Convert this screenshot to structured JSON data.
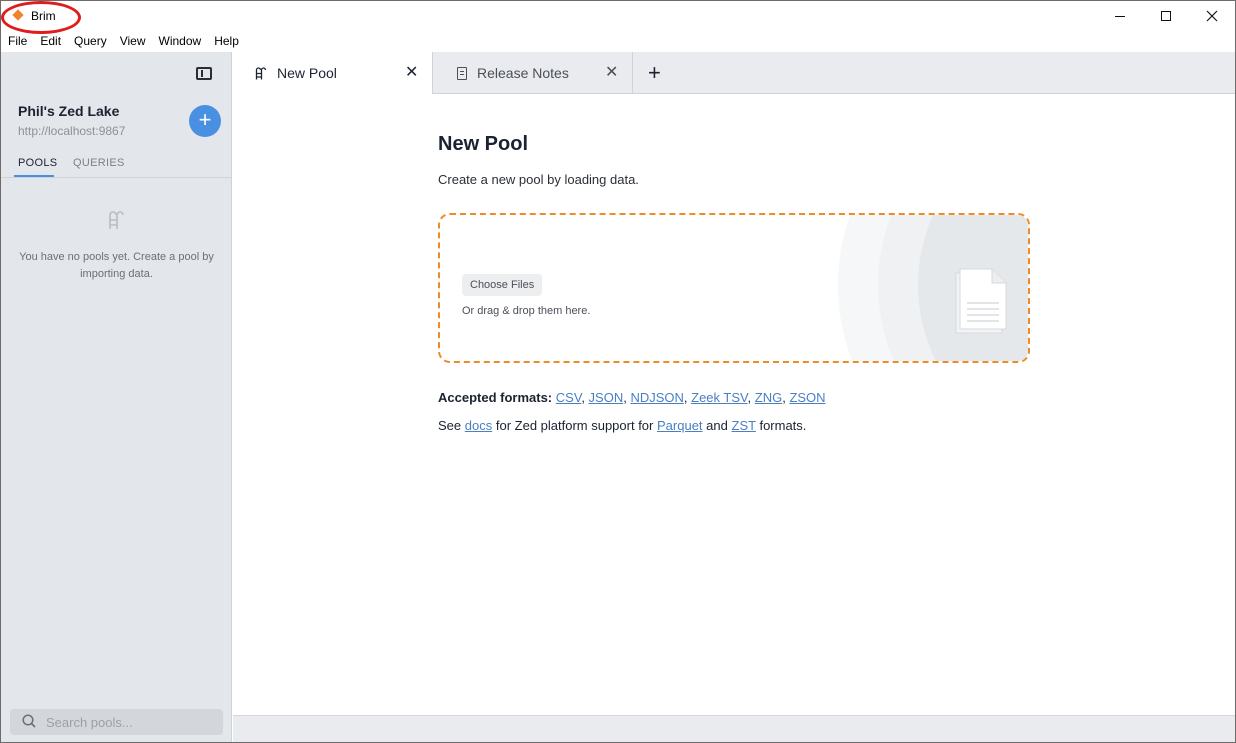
{
  "window": {
    "title": "Brim",
    "colors": {
      "accent": "#4a90e2",
      "dropzone_border": "#f08a24",
      "annotation": "#e01c1c"
    }
  },
  "menu": [
    "File",
    "Edit",
    "Query",
    "View",
    "Window",
    "Help"
  ],
  "sidebar": {
    "lake_name": "Phil's Zed Lake",
    "lake_url": "http://localhost:9867",
    "add_label": "+",
    "tabs": {
      "pools": "POOLS",
      "queries": "QUERIES"
    },
    "empty_message": "You have no pools yet. Create a pool by importing data.",
    "search_placeholder": "Search pools..."
  },
  "tabs": [
    {
      "label": "New Pool",
      "icon": "pool-icon",
      "active": true
    },
    {
      "label": "Release Notes",
      "icon": "document-icon",
      "active": false
    }
  ],
  "main": {
    "title": "New Pool",
    "subtitle": "Create a new pool by loading data.",
    "choose_files": "Choose Files",
    "drag_text": "Or drag & drop them here.",
    "accepted_label": "Accepted formats:",
    "formats": [
      "CSV",
      "JSON",
      "NDJSON",
      "Zeek TSV",
      "ZNG",
      "ZSON"
    ],
    "docs_prefix": "See",
    "docs_link": "docs",
    "docs_middle": "for Zed platform support for",
    "parquet": "Parquet",
    "and": "and",
    "zst": "ZST",
    "docs_suffix": "formats."
  }
}
